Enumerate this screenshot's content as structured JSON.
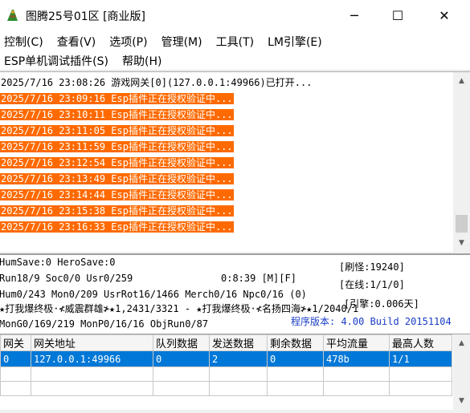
{
  "window": {
    "title": "图腾25号01区 [商业版]",
    "minimize": "─",
    "maximize": "☐",
    "close": "✕"
  },
  "menu": {
    "row1": [
      "控制(C)",
      "查看(V)",
      "选项(P)",
      "管理(M)",
      "工具(T)",
      "LM引擎(E)"
    ],
    "row2": [
      "ESP单机调试插件(S)",
      "帮助(H)"
    ]
  },
  "log": {
    "lines": [
      {
        "text": "2025/7/16 23:08:26 游戏网关[0](127.0.0.1:49966)已打开...",
        "highlight": false
      },
      {
        "text": "2025/7/16 23:09:16 Esp插件正在授权验证中...",
        "highlight": true
      },
      {
        "text": "2025/7/16 23:10:11 Esp插件正在授权验证中...",
        "highlight": true
      },
      {
        "text": "2025/7/16 23:11:05 Esp插件正在授权验证中...",
        "highlight": true
      },
      {
        "text": "2025/7/16 23:11:59 Esp插件正在授权验证中...",
        "highlight": true
      },
      {
        "text": "2025/7/16 23:12:54 Esp插件正在授权验证中...",
        "highlight": true
      },
      {
        "text": "2025/7/16 23:13:49 Esp插件正在授权验证中...",
        "highlight": true
      },
      {
        "text": "2025/7/16 23:14:44 Esp插件正在授权验证中...",
        "highlight": true
      },
      {
        "text": "2025/7/16 23:15:38 Esp插件正在授权验证中...",
        "highlight": true
      },
      {
        "text": "2025/7/16 23:16:33 Esp插件正在授权验证中...",
        "highlight": true
      }
    ],
    "highlight_color": "#ff6a00"
  },
  "status": {
    "save": "HumSave:0 HeroSave:0",
    "run": "Run18/9 Soc0/0 Usr0/259",
    "runtime": "0:8:39 [M][F]",
    "refresh": "[刷怪:19240]",
    "online": "[在线:1/1/0]",
    "hum": "Hum0/243 Mon0/209 UsrRot16/1466 Merch0/16 Npc0/16 (0)",
    "engine": "[引擎:0.006天]",
    "broadcast": "★打我爆终极·≮威震群雄≯★1,2431/3321 - ★打我爆终极·≮名扬四海≯★1/2040/1",
    "version": "程序版本: 4.00 Build 20151104",
    "mon": "MonG0/169/219 MonP0/16/16 ObjRun0/87"
  },
  "gateways": {
    "columns": [
      "网关",
      "网关地址",
      "队列数据",
      "发送数据",
      "剩余数据",
      "平均流量",
      "最高人数"
    ],
    "rows": [
      [
        "0",
        "127.0.0.1:49966",
        "0",
        "2",
        "0",
        "478b",
        "1/1"
      ]
    ]
  }
}
